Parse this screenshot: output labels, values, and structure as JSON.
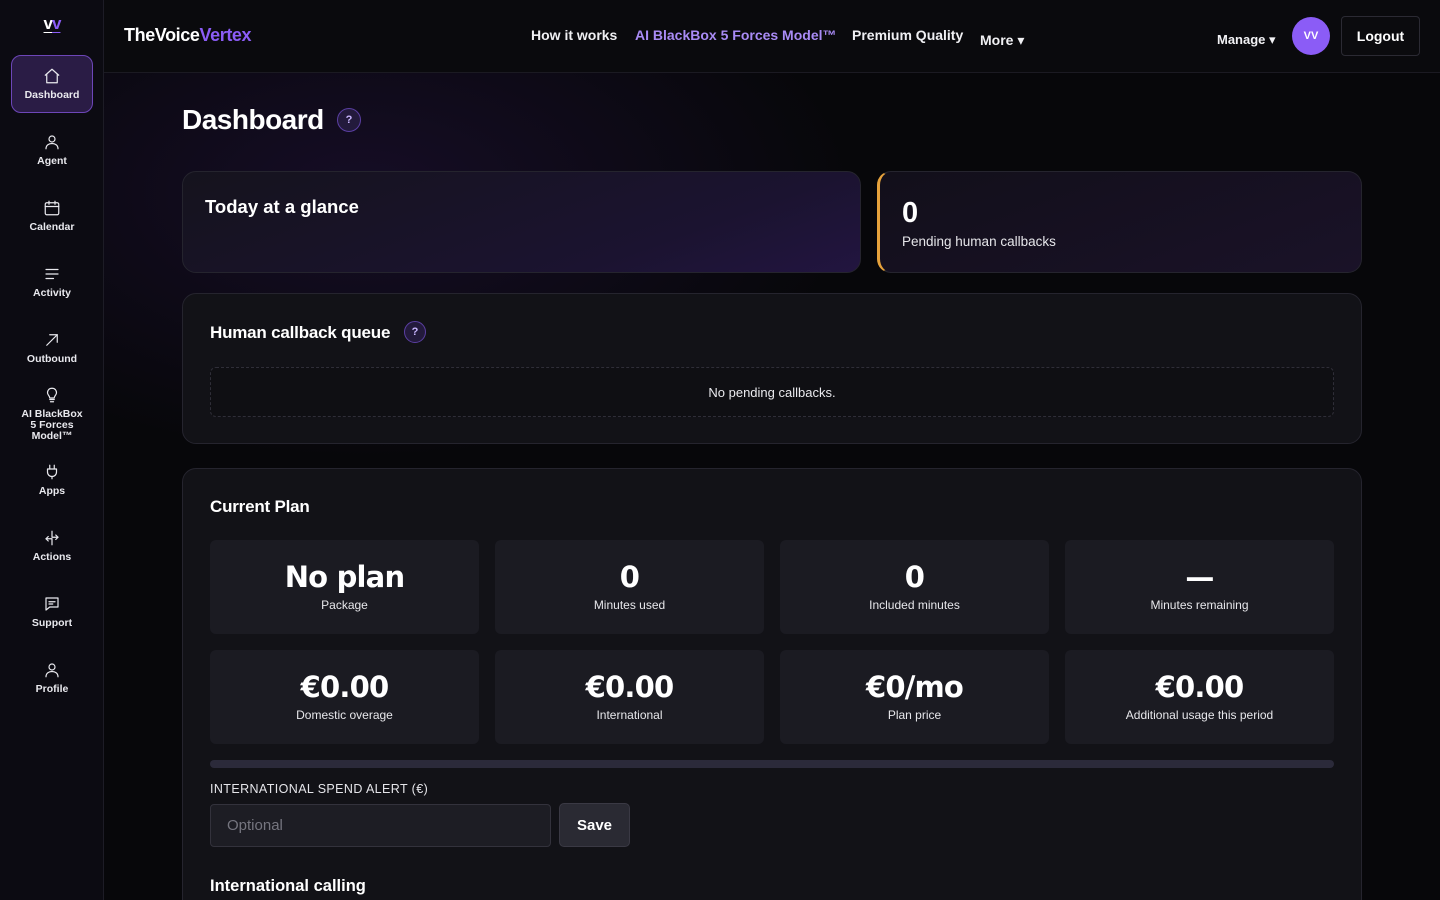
{
  "sidebar": {
    "logo": {
      "part1": "v",
      "part2": "v"
    },
    "items": [
      {
        "label": "Dashboard",
        "icon": "home-icon"
      },
      {
        "label": "Agent",
        "icon": "user-icon"
      },
      {
        "label": "Calendar",
        "icon": "calendar-icon"
      },
      {
        "label": "Activity",
        "icon": "list-icon"
      },
      {
        "label": "Outbound",
        "icon": "arrow-up-right-icon"
      },
      {
        "label": "AI BlackBox 5 Forces Model™",
        "icon": "lightbulb-icon"
      },
      {
        "label": "Apps",
        "icon": "plug-icon"
      },
      {
        "label": "Actions",
        "icon": "arrows-exchange-icon"
      },
      {
        "label": "Support",
        "icon": "message-icon"
      },
      {
        "label": "Profile",
        "icon": "profile-icon"
      }
    ]
  },
  "header": {
    "brand_part1": "TheVoice",
    "brand_part2": "Vertex",
    "nav": [
      "How it works",
      "AI BlackBox 5 Forces Model™",
      "Premium Quality",
      "More ▾"
    ],
    "manage": "Manage ▾",
    "avatar_initials": "VV",
    "logout": "Logout"
  },
  "main": {
    "title": "Dashboard",
    "help": "?",
    "glance_title": "Today at a glance",
    "pending": {
      "value": "0",
      "label": "Pending human callbacks"
    },
    "queue": {
      "title": "Human callback queue",
      "empty": "No pending callbacks."
    },
    "plan": {
      "title": "Current Plan",
      "stats": [
        {
          "value": "No plan",
          "label": "Package"
        },
        {
          "value": "0",
          "label": "Minutes used"
        },
        {
          "value": "0",
          "label": "Included minutes"
        },
        {
          "value": "—",
          "label": "Minutes remaining"
        },
        {
          "value": "€0.00",
          "label": "Domestic overage"
        },
        {
          "value": "€0.00",
          "label": "International"
        },
        {
          "value": "€0/mo",
          "label": "Plan price"
        },
        {
          "value": "€0.00",
          "label": "Additional usage this period"
        }
      ],
      "usage_progress": 0,
      "alert_label": "INTERNATIONAL SPEND ALERT (€)",
      "alert_placeholder": "Optional",
      "save": "Save",
      "intl_title": "International calling"
    }
  },
  "colors": {
    "accent": "#8b5cf6",
    "warning": "#e6a23c",
    "background": "#07070a"
  }
}
